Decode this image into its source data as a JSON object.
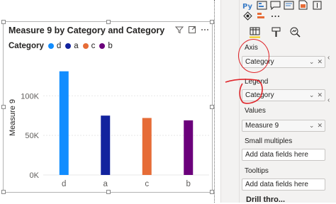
{
  "visual": {
    "title": "Measure 9 by Category and Category",
    "legend_title": "Category",
    "legend": [
      {
        "label": "d",
        "color": "#118dff"
      },
      {
        "label": "a",
        "color": "#12239e"
      },
      {
        "label": "c",
        "color": "#e66c37"
      },
      {
        "label": "b",
        "color": "#6b007b"
      }
    ],
    "header_icons": [
      "filter-icon",
      "focus-mode-icon",
      "more-options-icon"
    ]
  },
  "chart_data": {
    "type": "bar",
    "title": "Measure 9 by Category and Category",
    "categories": [
      "d",
      "a",
      "c",
      "b"
    ],
    "values": [
      131000,
      75000,
      72000,
      69000
    ],
    "colors": [
      "#118dff",
      "#12239e",
      "#e66c37",
      "#6b007b"
    ],
    "ylabel": "Measure 9",
    "xlabel": "",
    "yticks": [
      "0K",
      "50K",
      "100K"
    ],
    "ytick_values": [
      0,
      50000,
      100000
    ],
    "ylim": [
      0,
      145000
    ],
    "grid": true,
    "legend_position": "top-left"
  },
  "fields_pane": {
    "axis_label": "Axis",
    "axis_value": "Category",
    "legend_label": "Legend",
    "legend_value": "Category",
    "values_label": "Values",
    "values_value": "Measure 9",
    "small_multiples_label": "Small multiples",
    "small_multiples_placeholder": "Add data fields here",
    "tooltips_label": "Tooltips",
    "tooltips_placeholder": "Add data fields here",
    "drill_through_label": "Drill thro..."
  },
  "viz_gallery": {
    "icons": [
      "python-visual-icon",
      "key-influencers-icon",
      "qa-visual-icon",
      "smart-narrative-icon",
      "paginated-report-icon",
      "decomposition-tree-icon",
      "more-visuals-icon"
    ]
  },
  "pane_tabs": [
    "fields-tab-icon",
    "format-tab-icon",
    "analytics-tab-icon"
  ]
}
